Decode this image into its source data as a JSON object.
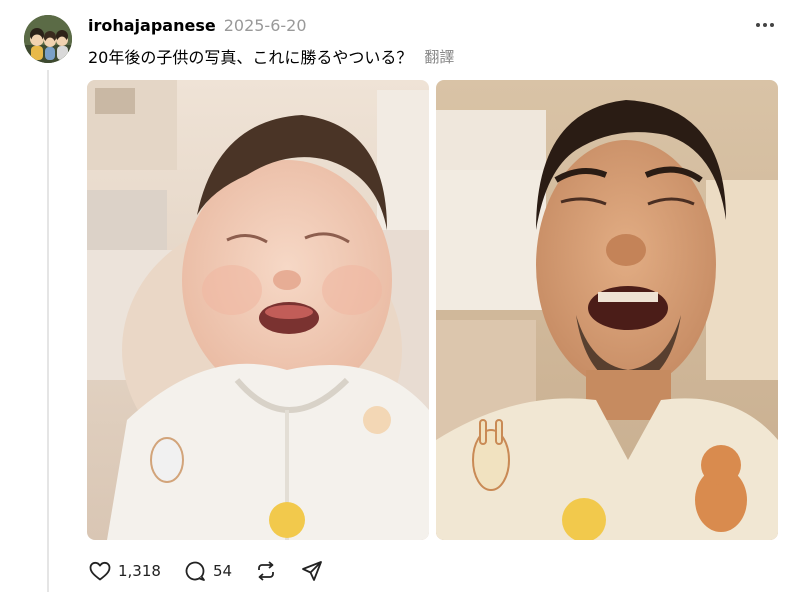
{
  "post": {
    "username": "irohajapanese",
    "date": "2025-6-20",
    "text": "20年後の子供の写真、これに勝るやついる？",
    "translate_label": "翻譯"
  },
  "actions": {
    "likes": "1,318",
    "replies": "54"
  },
  "icons": {
    "more": "more-options-icon",
    "like": "heart-icon",
    "reply": "comment-bubble-icon",
    "repost": "repost-icon",
    "share": "share-send-icon"
  },
  "colors": {
    "muted_text": "#999999",
    "thread_line": "#e5e5e5"
  }
}
